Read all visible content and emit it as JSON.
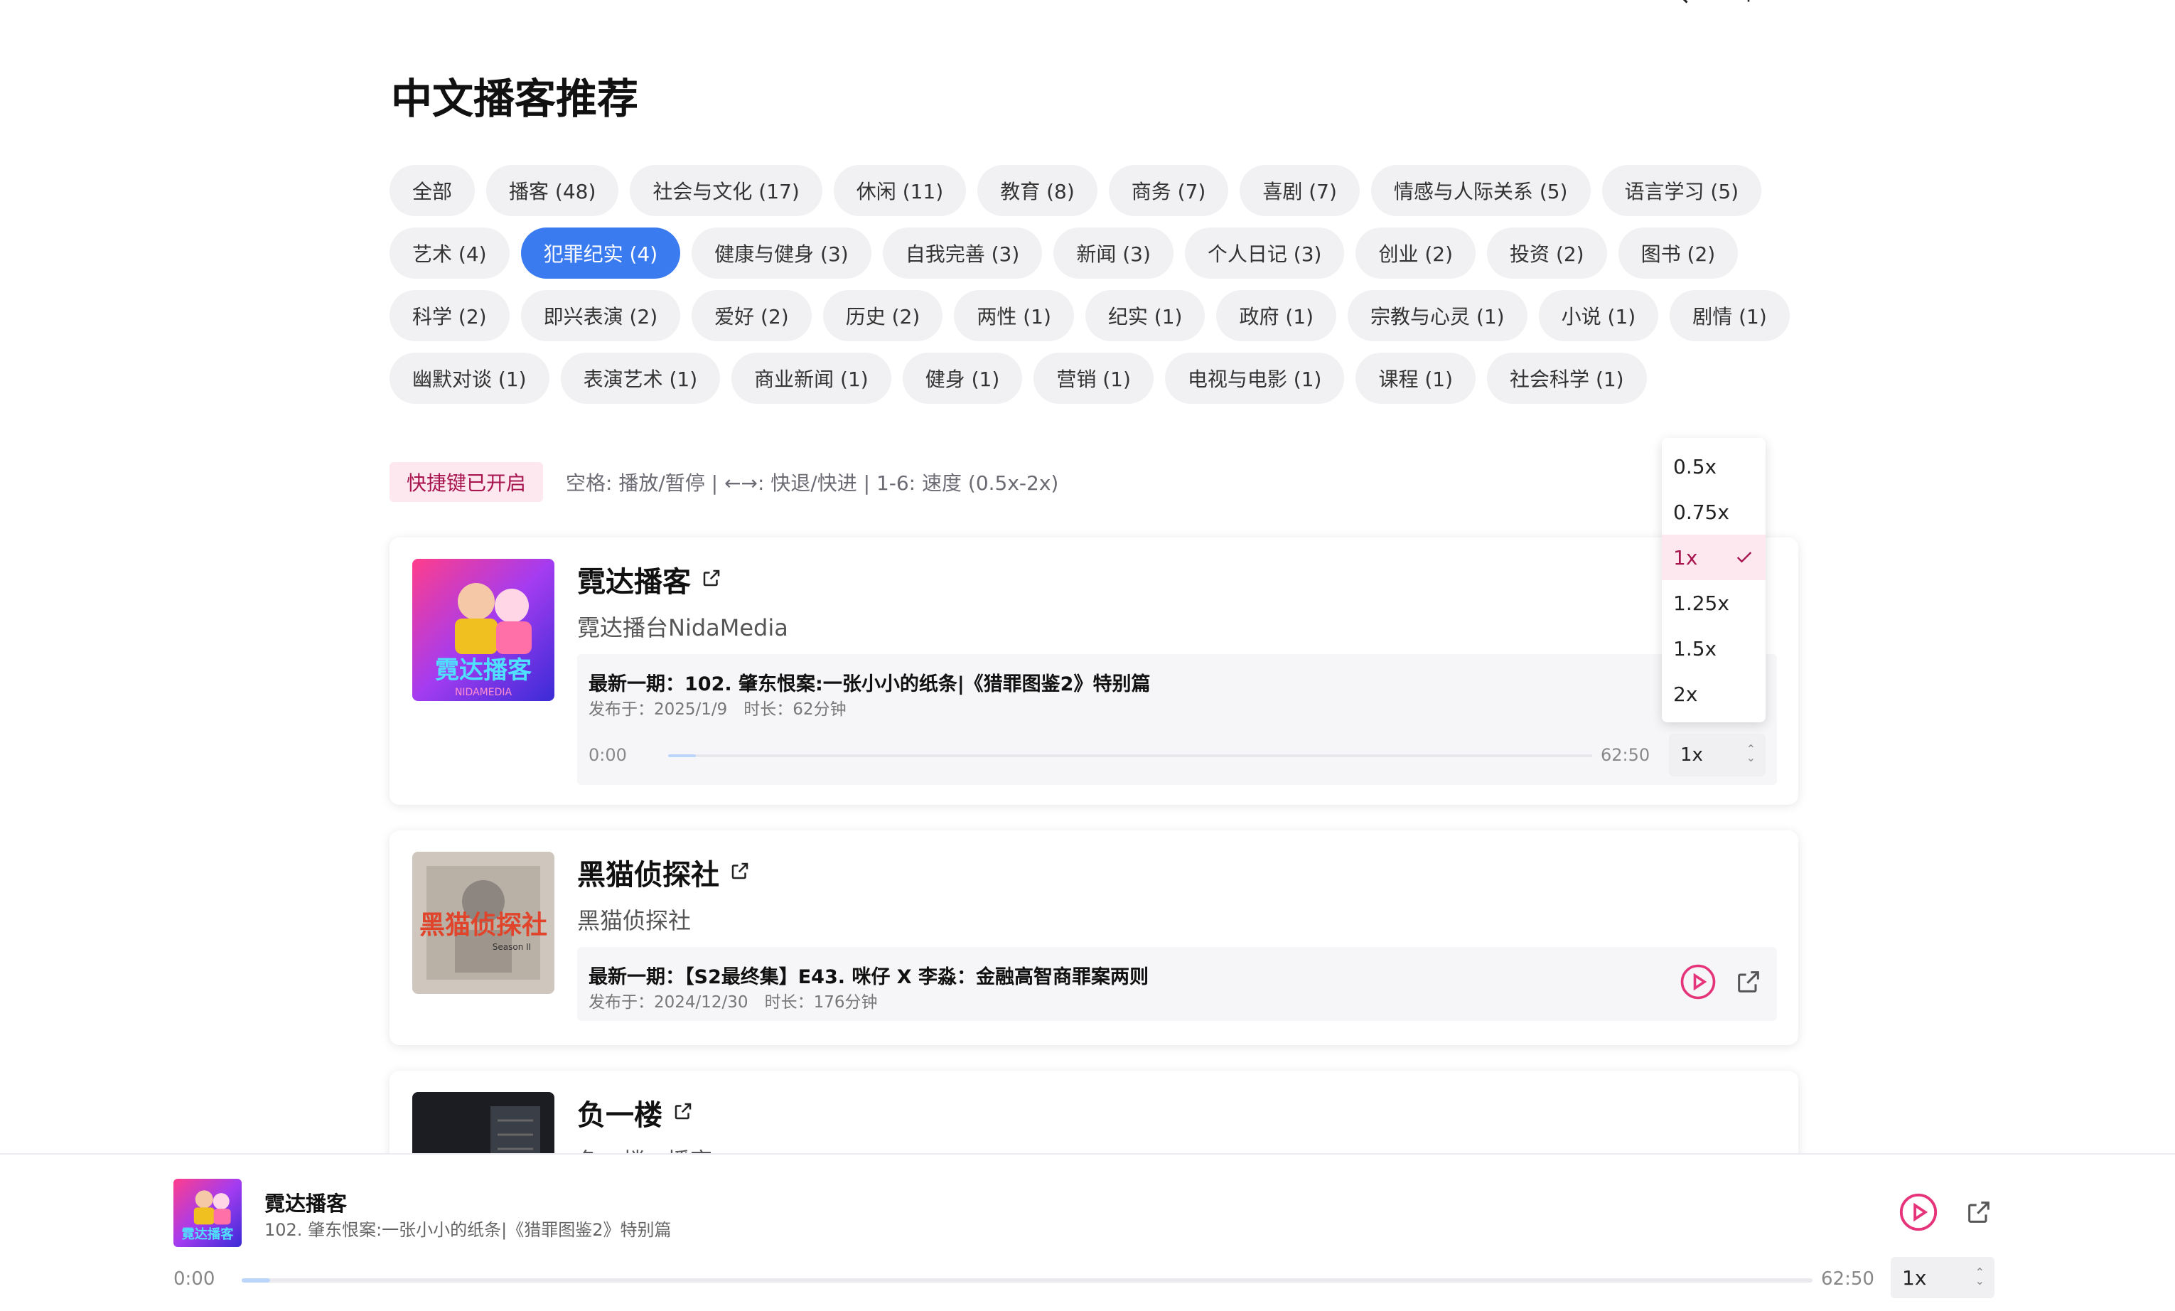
{
  "nav": {
    "items": [
      "…",
      "…",
      "…",
      "…"
    ]
  },
  "page_title": "中文播客推荐",
  "categories": [
    [
      "全部",
      "播客 (48)",
      "社会与文化 (17)",
      "休闲 (11)",
      "教育 (8)",
      "商务 (7)",
      "喜剧 (7)",
      "情感与人际关系 (5)",
      "语言学习 (5)"
    ],
    [
      "艺术 (4)",
      "犯罪纪实 (4)",
      "健康与健身 (3)",
      "自我完善 (3)",
      "新闻 (3)",
      "个人日记 (3)",
      "创业 (2)",
      "投资 (2)",
      "图书 (2)"
    ],
    [
      "科学 (2)",
      "即兴表演 (2)",
      "爱好 (2)",
      "历史 (2)",
      "两性 (1)",
      "纪实 (1)",
      "政府 (1)",
      "宗教与心灵 (1)",
      "小说 (1)",
      "剧情 (1)"
    ],
    [
      "幽默对谈 (1)",
      "表演艺术 (1)",
      "商业新闻 (1)",
      "健身 (1)",
      "营销 (1)",
      "电视与电影 (1)",
      "课程 (1)",
      "社会科学 (1)"
    ]
  ],
  "active_category": "犯罪纪实 (4)",
  "shortcuts": {
    "badge": "快捷键已开启",
    "help": "空格: 播放/暂停 | ←→: 快退/快进 | 1-6: 速度 (0.5x-2x)"
  },
  "podcasts": [
    {
      "title": "霓达播客",
      "author": "霓达播台NidaMedia",
      "episode_title": "最新一期：102. 肇东恨案:一张小小的纸条|《猎罪图鉴2》特别篇",
      "meta": "发布于：2025/1/9　时长：62分钟",
      "time_current": "0:00",
      "time_total": "62:50",
      "progress": 0.03,
      "speed": "1x"
    },
    {
      "title": "黑猫侦探社",
      "author": "黑猫侦探社",
      "episode_title": "最新一期：【S2最终集】E43. 咪仔 X 李淼：金融高智商罪案两则",
      "meta": "发布于：2024/12/30　时长：176分钟"
    },
    {
      "title": "负一楼",
      "author": "负一楼 · 播客"
    }
  ],
  "speed_options": [
    "0.5x",
    "0.75x",
    "1x",
    "1.25x",
    "1.5x",
    "2x"
  ],
  "speed_selected": "1x",
  "player": {
    "title": "霓达播客",
    "episode": "102. 肇东恨案:一张小小的纸条|《猎罪图鉴2》特别篇",
    "time_current": "0:00",
    "time_total": "62:50",
    "progress": 0.018,
    "speed": "1x"
  },
  "colors": {
    "accent_pink": "#e5347a",
    "active_chip": "#3a7bf0",
    "badge_bg": "#fde8ef"
  },
  "cover_art": {
    "nida_text": "霓达播客",
    "nida_sub": "NIDAMEDIA",
    "cat_text": "黑猫侦探社",
    "cat_season": "Season II"
  }
}
